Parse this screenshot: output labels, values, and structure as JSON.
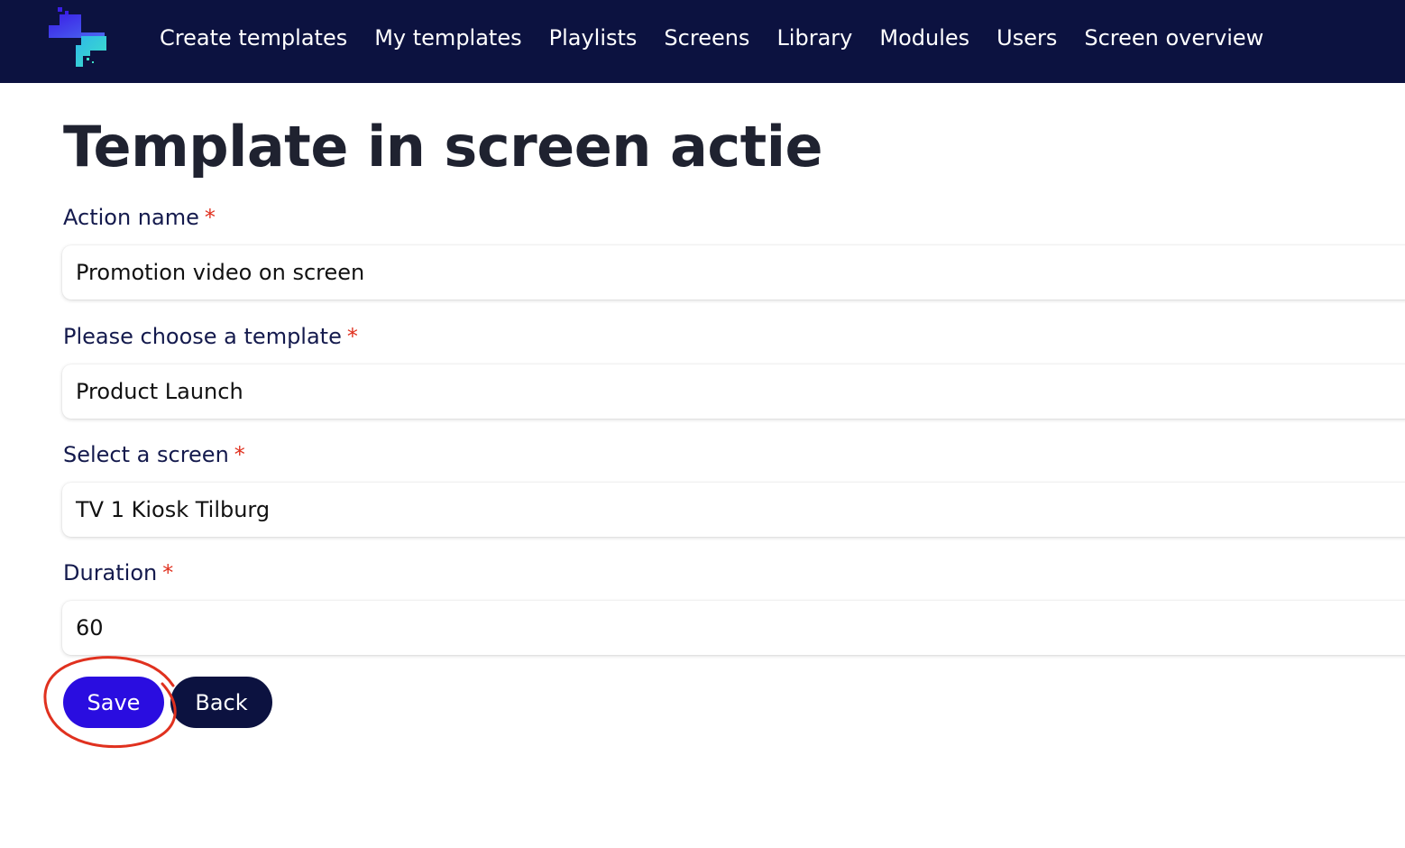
{
  "nav": {
    "logo_icon": "app-logo-icon",
    "items": [
      {
        "label": "Create templates"
      },
      {
        "label": "My templates"
      },
      {
        "label": "Playlists"
      },
      {
        "label": "Screens"
      },
      {
        "label": "Library"
      },
      {
        "label": "Modules"
      },
      {
        "label": "Users"
      },
      {
        "label": "Screen overview"
      }
    ]
  },
  "page": {
    "title": "Template in screen actie"
  },
  "form": {
    "action_name": {
      "label": "Action name",
      "required_marker": "*",
      "value": "Promotion video on screen"
    },
    "template": {
      "label": "Please choose a template",
      "required_marker": "*",
      "value": "Product Launch"
    },
    "screen": {
      "label": "Select a screen",
      "required_marker": "*",
      "value": "TV 1 Kiosk Tilburg"
    },
    "duration": {
      "label": "Duration",
      "required_marker": "*",
      "value": "60"
    }
  },
  "buttons": {
    "save_label": "Save",
    "back_label": "Back"
  },
  "colors": {
    "topbar": "#0c1240",
    "save_button": "#2a0de0",
    "back_button": "#0c1240",
    "required": "#e0311f",
    "annotation": "#e0311f"
  }
}
